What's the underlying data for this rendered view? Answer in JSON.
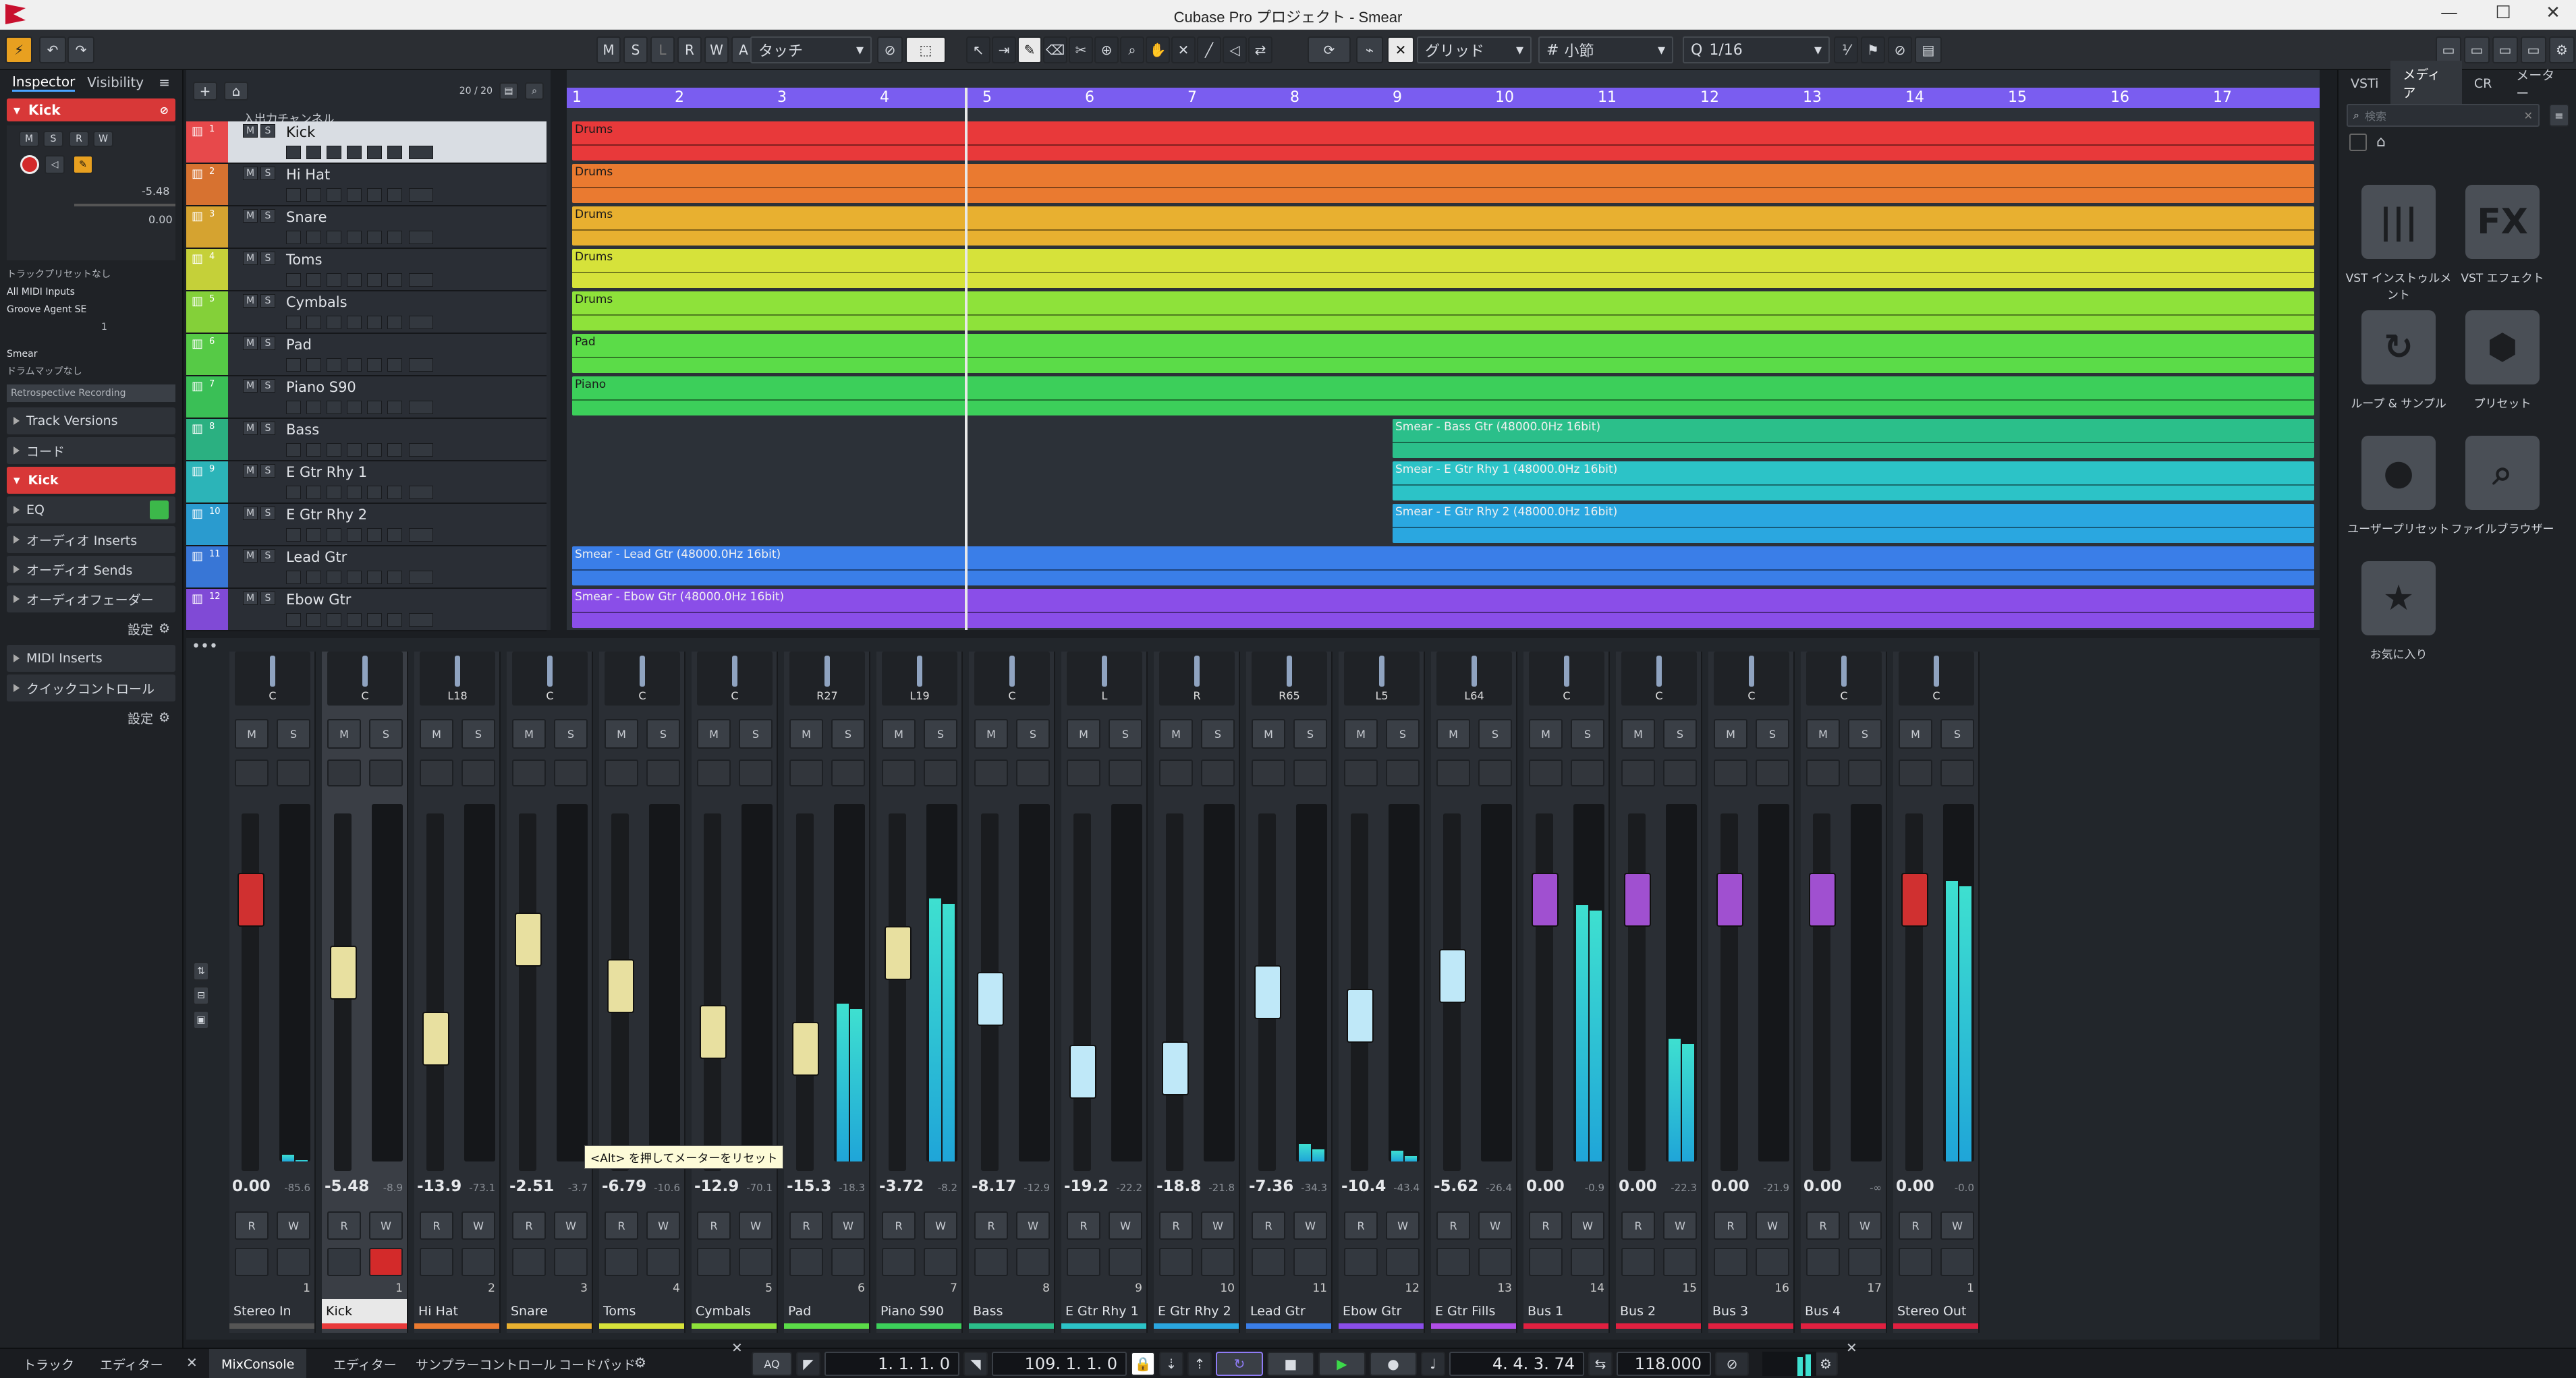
{
  "window": {
    "title": "Cubase Pro プロジェクト - Smear",
    "controls": [
      "—",
      "☐",
      "✕"
    ]
  },
  "toolbar": {
    "ms_buttons": [
      "M",
      "S",
      "L",
      "R",
      "W",
      "A"
    ],
    "automation_mode": "タッチ",
    "grid_type": "グリッド",
    "grid_value": "小節",
    "quantize": "1/16"
  },
  "inspector": {
    "tabs": [
      "Inspector",
      "Visibility"
    ],
    "track_name": "Kick",
    "volume": "-5.48",
    "pan": "0.00",
    "input_routing": "トラックプリセットなし",
    "midi_input": "All MIDI Inputs",
    "output": "Groove Agent SE",
    "channel": "1",
    "expression": "Smear",
    "drum_map": "ドラムマップなし",
    "retrospective": "Retrospective Recording",
    "sections": [
      "Track Versions",
      "コード"
    ],
    "channel_section": "Kick",
    "sections2": [
      "EQ",
      "オーディオ Inserts",
      "オーディオ Sends",
      "オーディオフェーダー"
    ],
    "settings_label": "設定",
    "sections3": [
      "MIDI Inserts",
      "クイックコントロール"
    ],
    "settings_label2": "設定"
  },
  "tracklist": {
    "count": "20 / 20",
    "folder": "入出力チャンネル",
    "tracks": [
      {
        "n": "1",
        "name": "Kick"
      },
      {
        "n": "2",
        "name": "Hi Hat"
      },
      {
        "n": "3",
        "name": "Snare"
      },
      {
        "n": "4",
        "name": "Toms"
      },
      {
        "n": "5",
        "name": "Cymbals"
      },
      {
        "n": "6",
        "name": "Pad"
      },
      {
        "n": "7",
        "name": "Piano S90"
      },
      {
        "n": "8",
        "name": "Bass"
      },
      {
        "n": "9",
        "name": "E Gtr Rhy 1"
      },
      {
        "n": "10",
        "name": "E Gtr Rhy 2"
      },
      {
        "n": "11",
        "name": "Lead Gtr"
      },
      {
        "n": "12",
        "name": "Ebow Gtr"
      }
    ]
  },
  "arrange": {
    "bars": [
      "1",
      "2",
      "3",
      "4",
      "5",
      "6",
      "7",
      "8",
      "9",
      "10",
      "11",
      "12",
      "13",
      "14",
      "15",
      "16",
      "17"
    ],
    "lanes": [
      {
        "label": "Drums",
        "color": "#e8393a",
        "start": 0
      },
      {
        "label": "Drums",
        "color": "#ea7a30",
        "start": 0
      },
      {
        "label": "Drums",
        "color": "#e8b030",
        "start": 0
      },
      {
        "label": "Drums",
        "color": "#d6e23a",
        "start": 0
      },
      {
        "label": "Drums",
        "color": "#8ee23a",
        "start": 0
      },
      {
        "label": "Pad",
        "color": "#5bdc48",
        "start": 0
      },
      {
        "label": "Piano",
        "color": "#3ccf5a",
        "start": 0
      },
      {
        "label": "Smear - Bass Gtr (48000.0Hz 16bit)",
        "color": "#2bbf8a",
        "start": 8
      },
      {
        "label": "Smear - E Gtr Rhy 1 (48000.0Hz 16bit)",
        "color": "#2cc3c7",
        "start": 8
      },
      {
        "label": "Smear - E Gtr Rhy 2 (48000.0Hz 16bit)",
        "color": "#2aa7e0",
        "start": 8
      },
      {
        "label": "Smear - Lead Gtr (48000.0Hz 16bit)",
        "color": "#3a7ee8",
        "start": 0
      },
      {
        "label": "Smear - Ebow Gtr (48000.0Hz 16bit)",
        "color": "#8a4ee8",
        "start": 0
      }
    ]
  },
  "mixer": {
    "strips": [
      {
        "pan": "C",
        "vol": "0.00",
        "peak": "-85.6",
        "name": "Stereo In",
        "ch": "1",
        "color": "#555",
        "cap": "#d03030",
        "level": 0.82,
        "meter": 0.02
      },
      {
        "pan": "C",
        "vol": "-5.48",
        "peak": "-8.9",
        "name": "Kick",
        "ch": "1",
        "color": "#e8393a",
        "cap": "#e8e0a0",
        "level": 0.6,
        "meter": 0.0
      },
      {
        "pan": "L18",
        "vol": "-13.9",
        "peak": "-73.1",
        "name": "Hi Hat",
        "ch": "2",
        "color": "#ea7a30",
        "cap": "#e8e0a0",
        "level": 0.4,
        "meter": 0.0
      },
      {
        "pan": "C",
        "vol": "-2.51",
        "peak": "-3.7",
        "name": "Snare",
        "ch": "3",
        "color": "#e8b030",
        "cap": "#e8e0a0",
        "level": 0.7,
        "meter": 0.0
      },
      {
        "pan": "C",
        "vol": "-6.79",
        "peak": "-10.6",
        "name": "Toms",
        "ch": "4",
        "color": "#d6e23a",
        "cap": "#e8e0a0",
        "level": 0.56,
        "meter": 0.0
      },
      {
        "pan": "C",
        "vol": "-12.9",
        "peak": "-70.1",
        "name": "Cymbals",
        "ch": "5",
        "color": "#8ee23a",
        "cap": "#e8e0a0",
        "level": 0.42,
        "meter": 0.0
      },
      {
        "pan": "R27",
        "vol": "-15.3",
        "peak": "-18.3",
        "name": "Pad",
        "ch": "6",
        "color": "#5bdc48",
        "cap": "#e8e0a0",
        "level": 0.37,
        "meter": 0.45
      },
      {
        "pan": "L19",
        "vol": "-3.72",
        "peak": "-8.2",
        "name": "Piano S90",
        "ch": "7",
        "color": "#3ccf5a",
        "cap": "#e8e0a0",
        "level": 0.66,
        "meter": 0.75
      },
      {
        "pan": "C",
        "vol": "-8.17",
        "peak": "-12.9",
        "name": "Bass",
        "ch": "8",
        "color": "#2bbf8a",
        "cap": "#bfe8f8",
        "level": 0.52,
        "meter": 0.0
      },
      {
        "pan": "L",
        "vol": "-19.2",
        "peak": "-22.2",
        "name": "E Gtr Rhy 1",
        "ch": "9",
        "color": "#2cc3c7",
        "cap": "#bfe8f8",
        "level": 0.3,
        "meter": 0.0
      },
      {
        "pan": "R",
        "vol": "-18.8",
        "peak": "-21.8",
        "name": "E Gtr Rhy 2",
        "ch": "10",
        "color": "#2aa7e0",
        "cap": "#bfe8f8",
        "level": 0.31,
        "meter": 0.0
      },
      {
        "pan": "R65",
        "vol": "-7.36",
        "peak": "-34.3",
        "name": "Lead Gtr",
        "ch": "11",
        "color": "#3a7ee8",
        "cap": "#bfe8f8",
        "level": 0.54,
        "meter": 0.05
      },
      {
        "pan": "L5",
        "vol": "-10.4",
        "peak": "-43.4",
        "name": "Ebow Gtr",
        "ch": "12",
        "color": "#8a4ee8",
        "cap": "#bfe8f8",
        "level": 0.47,
        "meter": 0.03
      },
      {
        "pan": "L64",
        "vol": "-5.62",
        "peak": "-26.4",
        "name": "E Gtr Fills",
        "ch": "13",
        "color": "#b04ee8",
        "cap": "#bfe8f8",
        "level": 0.59,
        "meter": 0.0
      },
      {
        "pan": "C",
        "vol": "0.00",
        "peak": "-0.9",
        "name": "Bus 1",
        "ch": "14",
        "color": "#e02040",
        "cap": "#a050d0",
        "level": 0.82,
        "meter": 0.73
      },
      {
        "pan": "C",
        "vol": "0.00",
        "peak": "-22.3",
        "name": "Bus 2",
        "ch": "15",
        "color": "#e02040",
        "cap": "#a050d0",
        "level": 0.82,
        "meter": 0.35
      },
      {
        "pan": "C",
        "vol": "0.00",
        "peak": "-21.9",
        "name": "Bus 3",
        "ch": "16",
        "color": "#e02040",
        "cap": "#a050d0",
        "level": 0.82,
        "meter": 0.0
      },
      {
        "pan": "C",
        "vol": "0.00",
        "peak": "-∞",
        "name": "Bus 4",
        "ch": "17",
        "color": "#e02040",
        "cap": "#a050d0",
        "level": 0.82,
        "meter": 0.0
      },
      {
        "pan": "C",
        "vol": "0.00",
        "peak": "-0.0",
        "name": "Stereo Out",
        "ch": "1",
        "color": "#e02040",
        "cap": "#d03030",
        "level": 0.82,
        "meter": 0.8
      }
    ],
    "tooltip": "<Alt> を押してメーターをリセット"
  },
  "rightpanel": {
    "tabs": [
      "VSTi",
      "メディア",
      "CR",
      "メーター"
    ],
    "search_placeholder": "検索",
    "tiles": [
      {
        "icon": "|||",
        "label": "VST インストゥルメント"
      },
      {
        "icon": "FX",
        "label": "VST エフェクト"
      },
      {
        "icon": "↻",
        "label": "ループ & サンプル"
      },
      {
        "icon": "⬢",
        "label": "プリセット"
      },
      {
        "icon": "●",
        "label": "ユーザープリセット"
      },
      {
        "icon": "⌕",
        "label": "ファイルブラウザー"
      },
      {
        "icon": "★",
        "label": "お気に入り"
      }
    ]
  },
  "bottombar": {
    "left_tabs": [
      "トラック",
      "エディター"
    ],
    "tabs": [
      "MixConsole",
      "エディター",
      "サンプラーコントロール",
      "コードパッド"
    ],
    "aq": "AQ",
    "left_locator": "1. 1. 1.  0",
    "right_locator": "109. 1. 1.  0",
    "position": "4. 4. 3. 74",
    "tempo": "118.000"
  }
}
